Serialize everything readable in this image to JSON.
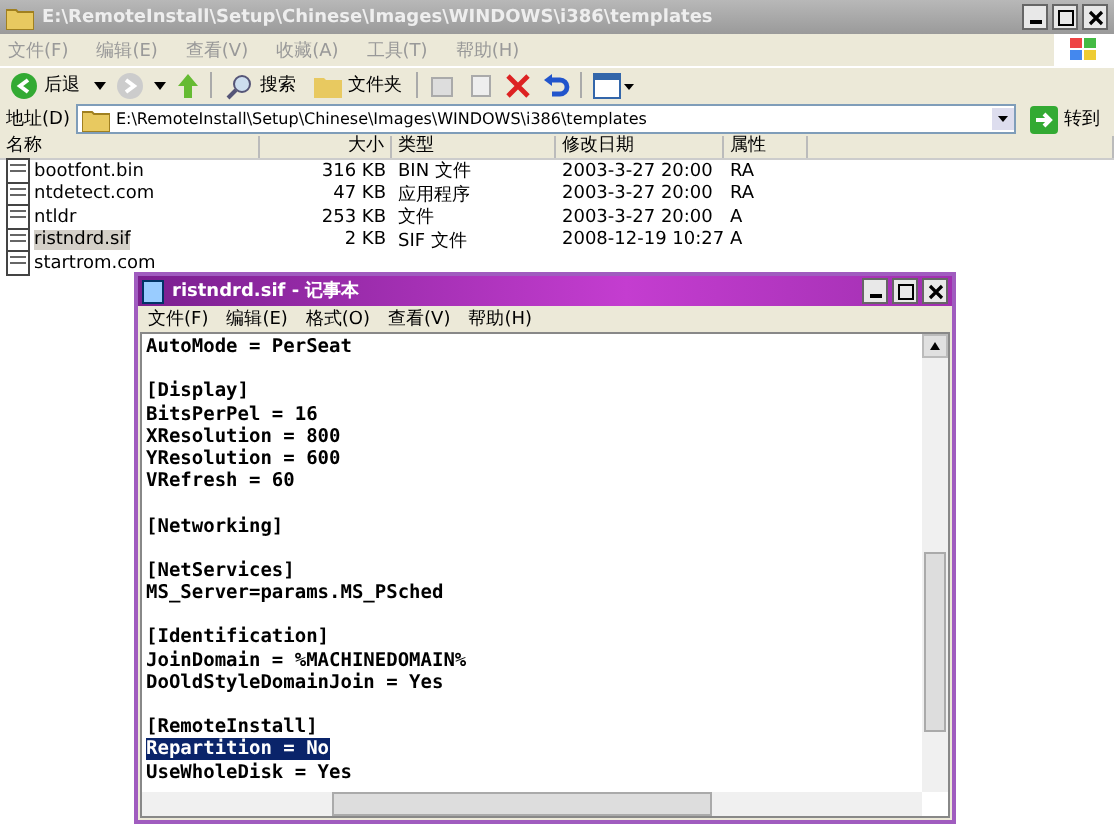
{
  "explorer": {
    "title": "E:\\RemoteInstall\\Setup\\Chinese\\Images\\WINDOWS\\i386\\templates",
    "menu": [
      "文件(F)",
      "编辑(E)",
      "查看(V)",
      "收藏(A)",
      "工具(T)",
      "帮助(H)"
    ],
    "toolbar": {
      "back": "后退",
      "search": "搜索",
      "folders": "文件夹"
    },
    "address": {
      "label": "地址(D)",
      "value": "E:\\RemoteInstall\\Setup\\Chinese\\Images\\WINDOWS\\i386\\templates",
      "go": "转到"
    },
    "columns": [
      "名称",
      "大小",
      "类型",
      "修改日期",
      "属性"
    ],
    "rows": [
      {
        "name": "bootfont.bin",
        "size": "316 KB",
        "type": "BIN 文件",
        "date": "2003-3-27 20:00",
        "attr": "RA",
        "selected": false
      },
      {
        "name": "ntdetect.com",
        "size": "47 KB",
        "type": "应用程序",
        "date": "2003-3-27 20:00",
        "attr": "RA",
        "selected": false
      },
      {
        "name": "ntldr",
        "size": "253 KB",
        "type": "文件",
        "date": "2003-3-27 20:00",
        "attr": "A",
        "selected": false
      },
      {
        "name": "ristndrd.sif",
        "size": "2 KB",
        "type": "SIF 文件",
        "date": "2008-12-19 10:27",
        "attr": "A",
        "selected": true
      },
      {
        "name": "startrom.com",
        "selected": false
      }
    ]
  },
  "notepad": {
    "title": "ristndrd.sif - 记事本",
    "menu": [
      "文件(F)",
      "编辑(E)",
      "格式(O)",
      "查看(V)",
      "帮助(H)"
    ],
    "lines": [
      {
        "text": "AutoMode = PerSeat",
        "selected": false
      },
      {
        "selected": false
      },
      {
        "text": "[Display]",
        "selected": false
      },
      {
        "text": "BitsPerPel = 16",
        "selected": false
      },
      {
        "text": "XResolution = 800",
        "selected": false
      },
      {
        "text": "YResolution = 600",
        "selected": false
      },
      {
        "text": "VRefresh = 60",
        "selected": false
      },
      {
        "selected": false
      },
      {
        "text": "[Networking]",
        "selected": false
      },
      {
        "selected": false
      },
      {
        "text": "[NetServices]",
        "selected": false
      },
      {
        "text": "MS_Server=params.MS_PSched",
        "selected": false
      },
      {
        "selected": false
      },
      {
        "text": "[Identification]",
        "selected": false
      },
      {
        "text": "JoinDomain = %MACHINEDOMAIN%",
        "selected": false
      },
      {
        "text": "DoOldStyleDomainJoin = Yes",
        "selected": false
      },
      {
        "selected": false
      },
      {
        "text": "[RemoteInstall]",
        "selected": false
      },
      {
        "text": "Repartition = No",
        "selected": true
      },
      {
        "text": "UseWholeDisk = Yes",
        "selected": false
      }
    ]
  }
}
